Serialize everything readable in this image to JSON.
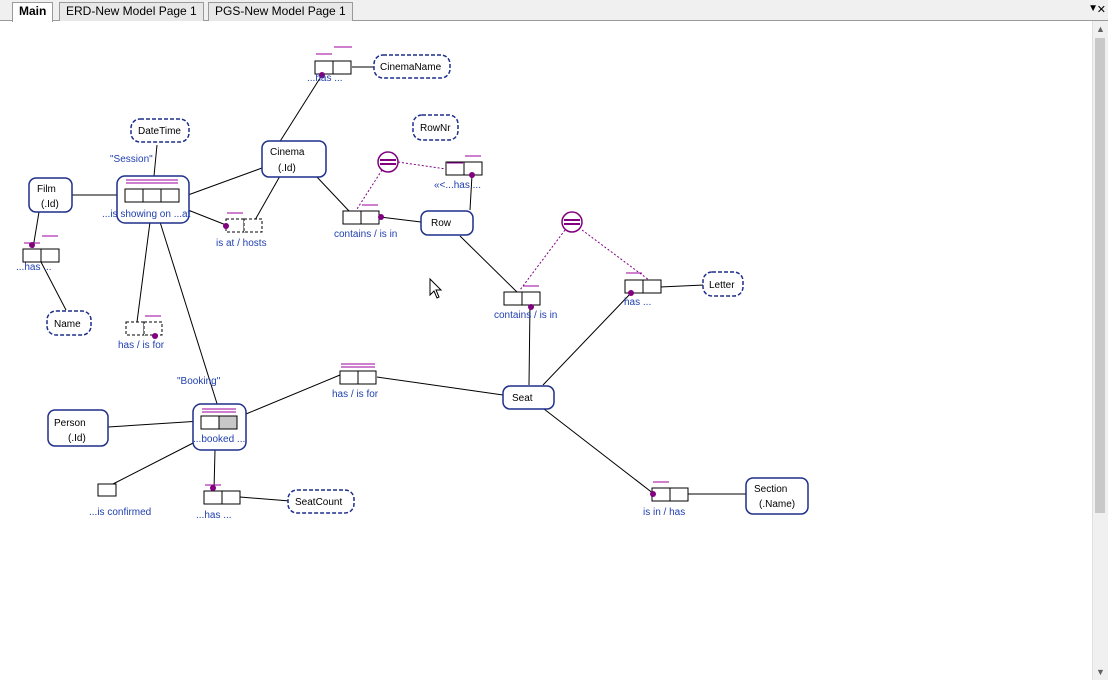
{
  "tabs": [
    {
      "label": "Main",
      "active": true
    },
    {
      "label": "ERD-New Model Page 1",
      "active": false
    },
    {
      "label": "PGS-New Model Page 1",
      "active": false
    }
  ],
  "colors": {
    "entity_border": "#1f2f8a",
    "role_label": "#1f3fb0",
    "constraint": "#800080"
  },
  "entities": {
    "film": {
      "name": "Film",
      "ref": "(.Id)"
    },
    "cinema": {
      "name": "Cinema",
      "ref": "(.Id)"
    },
    "row": {
      "name": "Row"
    },
    "person": {
      "name": "Person",
      "ref": "(.Id)"
    },
    "seat": {
      "name": "Seat"
    },
    "section": {
      "name": "Section",
      "ref": "(.Name)"
    }
  },
  "value_types": {
    "cinema_name": "CinemaName",
    "date_time": "DateTime",
    "row_nr": "RowNr",
    "name": "Name",
    "letter": "Letter",
    "seat_count": "SeatCount"
  },
  "objectified": {
    "session": "\"Session\"",
    "booking": "\"Booking\""
  },
  "fact_readings": {
    "cinema_has": "...has ...",
    "session": "...is showing on ...at",
    "film_has": "...has ...",
    "is_at": "is at  / hosts",
    "contains_row": "contains  / is in",
    "row_has": "«<...has ...",
    "contains_seat": "contains  / is in",
    "seat_has": "has ...",
    "has_is_for_left": "has  / is for",
    "has_is_for_mid": "has  / is for",
    "booked": "...booked ...",
    "is_confirmed": "...is confirmed",
    "booking_has": "...has ...",
    "is_in_has": "is in  / has"
  }
}
